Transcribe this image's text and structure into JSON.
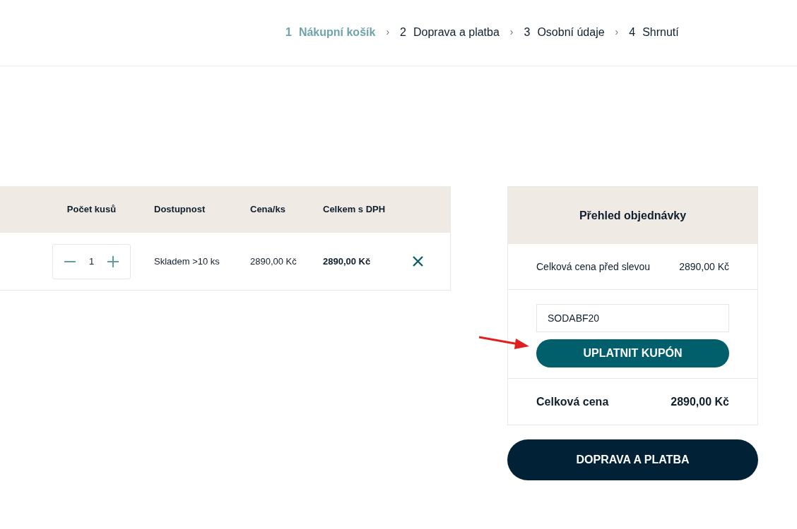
{
  "steps": [
    {
      "number": "1",
      "label": "Nákupní košík",
      "selected": true
    },
    {
      "number": "2",
      "label": "Doprava a platba",
      "selected": false
    },
    {
      "number": "3",
      "label": "Osobní údaje",
      "selected": false
    },
    {
      "number": "4",
      "label": "Shrnutí",
      "selected": false
    }
  ],
  "step_separator": "›",
  "cart_table": {
    "columns": [
      "Počet kusů",
      "Dostupnost",
      "Cena/ks",
      "Celkem s DPH"
    ],
    "rows": [
      {
        "quantity": "1",
        "availability": "Skladem >10 ks",
        "unit_price": "2890,00 Kč",
        "total": "2890,00 Kč"
      }
    ]
  },
  "order_summary": {
    "title": "Přehled objednávky",
    "subtotal_label": "Celková cena před slevou",
    "subtotal": "2890,00 Kč",
    "coupon": {
      "value": "SODABF20"
    },
    "apply_button": "UPLATNIT KUPÓN",
    "total_label": "Celková cena",
    "total": "2890,00 Kč"
  },
  "continue_button": "DOPRAVA A PLATBA"
}
